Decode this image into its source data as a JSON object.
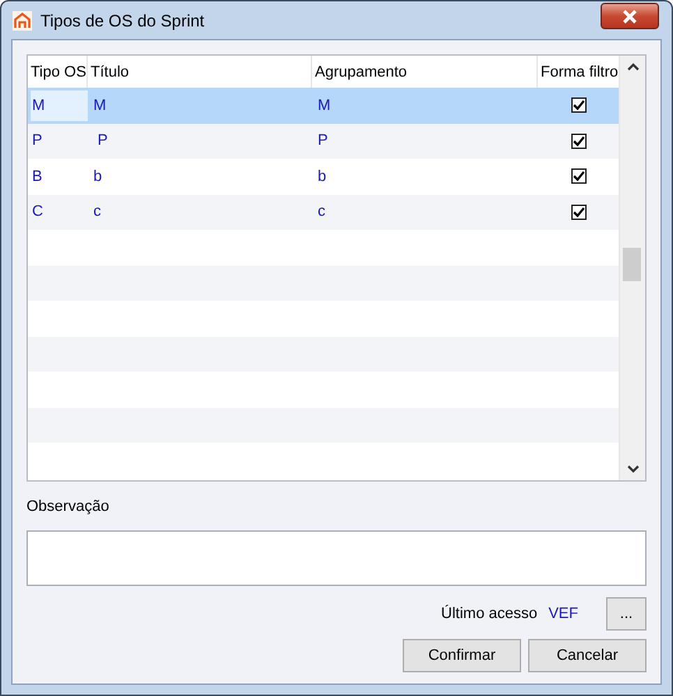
{
  "window": {
    "title": "Tipos de OS do Sprint"
  },
  "table": {
    "columns": [
      "Tipo OS",
      "Título",
      "Agrupamento",
      "Forma filtro"
    ],
    "rows": [
      {
        "tipo": "M",
        "titulo": "M",
        "agrupamento": "M",
        "forma_filtro": true,
        "selected": true
      },
      {
        "tipo": "P",
        "titulo": " P",
        "agrupamento": "P",
        "forma_filtro": true,
        "selected": false
      },
      {
        "tipo": "B",
        "titulo": "b",
        "agrupamento": "b",
        "forma_filtro": true,
        "selected": false
      },
      {
        "tipo": "C",
        "titulo": "c",
        "agrupamento": "c",
        "forma_filtro": true,
        "selected": false
      }
    ]
  },
  "observacao": {
    "label": "Observação"
  },
  "ultimo_acesso": {
    "label": "Último acesso",
    "value": "VEF",
    "button": "..."
  },
  "buttons": [
    "Confirmar",
    "Cancelar"
  ]
}
